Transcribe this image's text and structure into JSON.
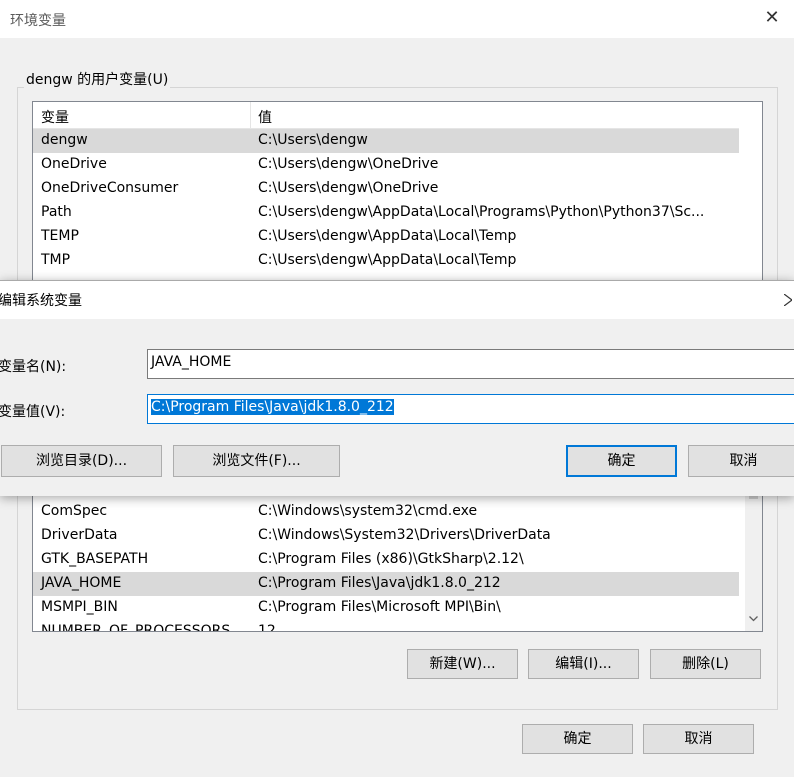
{
  "env_window": {
    "title": "环境变量",
    "close_glyph": "✕",
    "user_section_title": "dengw 的用户变量(U)",
    "columns": {
      "name": "变量",
      "value": "值"
    },
    "user_vars": [
      {
        "name": "dengw",
        "value": "C:\\Users\\dengw"
      },
      {
        "name": "OneDrive",
        "value": "C:\\Users\\dengw\\OneDrive"
      },
      {
        "name": "OneDriveConsumer",
        "value": "C:\\Users\\dengw\\OneDrive"
      },
      {
        "name": "Path",
        "value": "C:\\Users\\dengw\\AppData\\Local\\Programs\\Python\\Python37\\Sc..."
      },
      {
        "name": "TEMP",
        "value": "C:\\Users\\dengw\\AppData\\Local\\Temp"
      },
      {
        "name": "TMP",
        "value": "C:\\Users\\dengw\\AppData\\Local\\Temp"
      }
    ],
    "system_vars": [
      {
        "name": "ComSpec",
        "value": "C:\\Windows\\system32\\cmd.exe"
      },
      {
        "name": "DriverData",
        "value": "C:\\Windows\\System32\\Drivers\\DriverData"
      },
      {
        "name": "GTK_BASEPATH",
        "value": "C:\\Program Files (x86)\\GtkSharp\\2.12\\"
      },
      {
        "name": "JAVA_HOME",
        "value": "C:\\Program Files\\Java\\jdk1.8.0_212"
      },
      {
        "name": "MSMPI_BIN",
        "value": "C:\\Program Files\\Microsoft MPI\\Bin\\"
      },
      {
        "name": "NUMBER_OF_PROCESSORS",
        "value": "12"
      }
    ],
    "system_buttons": {
      "new": "新建(W)...",
      "edit": "编辑(I)...",
      "delete": "删除(L)"
    },
    "footer_buttons": {
      "ok": "确定",
      "cancel": "取消"
    }
  },
  "edit_dialog": {
    "title": "编辑系统变量",
    "close_glyph": "✕",
    "name_label": "变量名(N):",
    "name_value": "JAVA_HOME",
    "value_label": "变量值(V):",
    "value_value": "C:\\Program Files\\Java\\jdk1.8.0_212",
    "browse_dir": "浏览目录(D)...",
    "browse_file": "浏览文件(F)...",
    "ok": "确定",
    "cancel": "取消"
  }
}
